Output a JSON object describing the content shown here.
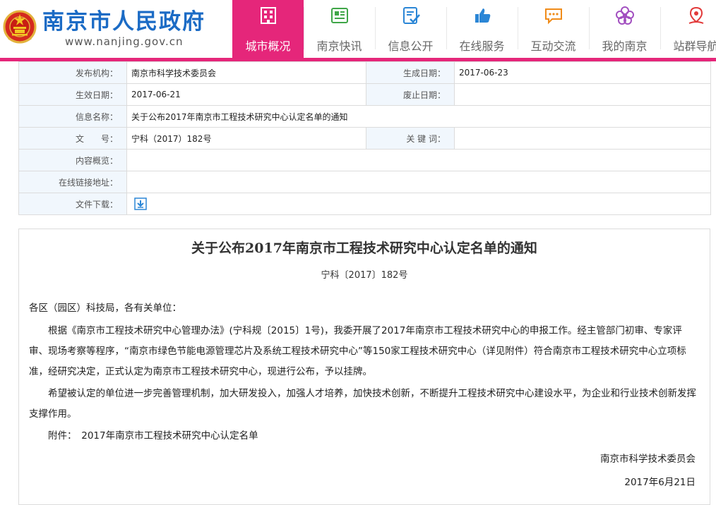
{
  "header": {
    "site_title": "南京市人民政府",
    "site_url": "www.nanjing.gov.cn",
    "nav": [
      {
        "label": "城市概况",
        "icon": "city-overview-icon",
        "active": true
      },
      {
        "label": "南京快讯",
        "icon": "news-icon"
      },
      {
        "label": "信息公开",
        "icon": "info-disclosure-icon"
      },
      {
        "label": "在线服务",
        "icon": "thumbs-up-icon"
      },
      {
        "label": "互动交流",
        "icon": "chat-bubble-icon"
      },
      {
        "label": "我的南京",
        "icon": "flower-icon"
      },
      {
        "label": "站群导航",
        "icon": "map-pin-icon"
      }
    ]
  },
  "meta": {
    "publisher_label": "发布机构：",
    "publisher_value": "南京市科学技术委员会",
    "created_label": "生成日期：",
    "created_value": "2017-06-23",
    "effective_label": "生效日期：",
    "effective_value": "2017-06-21",
    "repeal_label": "废止日期：",
    "repeal_value": "",
    "name_label": "信息名称：",
    "name_value": "关于公布2017年南京市工程技术研究中心认定名单的通知",
    "docnum_label": "文　　号：",
    "docnum_value": "宁科（2017）182号",
    "keywords_label": "关 键 词：",
    "keywords_value": "",
    "summary_label": "内容概览：",
    "summary_value": "",
    "link_label": "在线链接地址：",
    "link_value": "",
    "download_label": "文件下载：",
    "download_icon": "download-icon"
  },
  "article": {
    "title": "关于公布2017年南京市工程技术研究中心认定名单的通知",
    "doc_number": "宁科〔2017〕182号",
    "salutation": "各区（园区）科技局，各有关单位：",
    "p1": "根据《南京市工程技术研究中心管理办法》(宁科规〔2015〕1号)，我委开展了2017年南京市工程技术研究中心的申报工作。经主管部门初审、专家评审、现场考察等程序，“南京市绿色节能电源管理芯片及系统工程技术研究中心”等150家工程技术研究中心（详见附件）符合南京市工程技术研究中心立项标准，经研究决定，正式认定为南京市工程技术研究中心，现进行公布，予以挂牌。",
    "p2": "希望被认定的单位进一步完善管理机制，加大研发投入，加强人才培养，加快技术创新，不断提升工程技术研究中心建设水平，为企业和行业技术创新发挥支撑作用。",
    "attachment": "附件：　2017年南京市工程技术研究中心认定名单",
    "signature": "南京市科学技术委员会",
    "date": "2017年6月21日"
  },
  "colors": {
    "brand_pink": "#e5267a",
    "title_blue": "#1b6bc5",
    "label_bg": "#f1f7fd"
  }
}
